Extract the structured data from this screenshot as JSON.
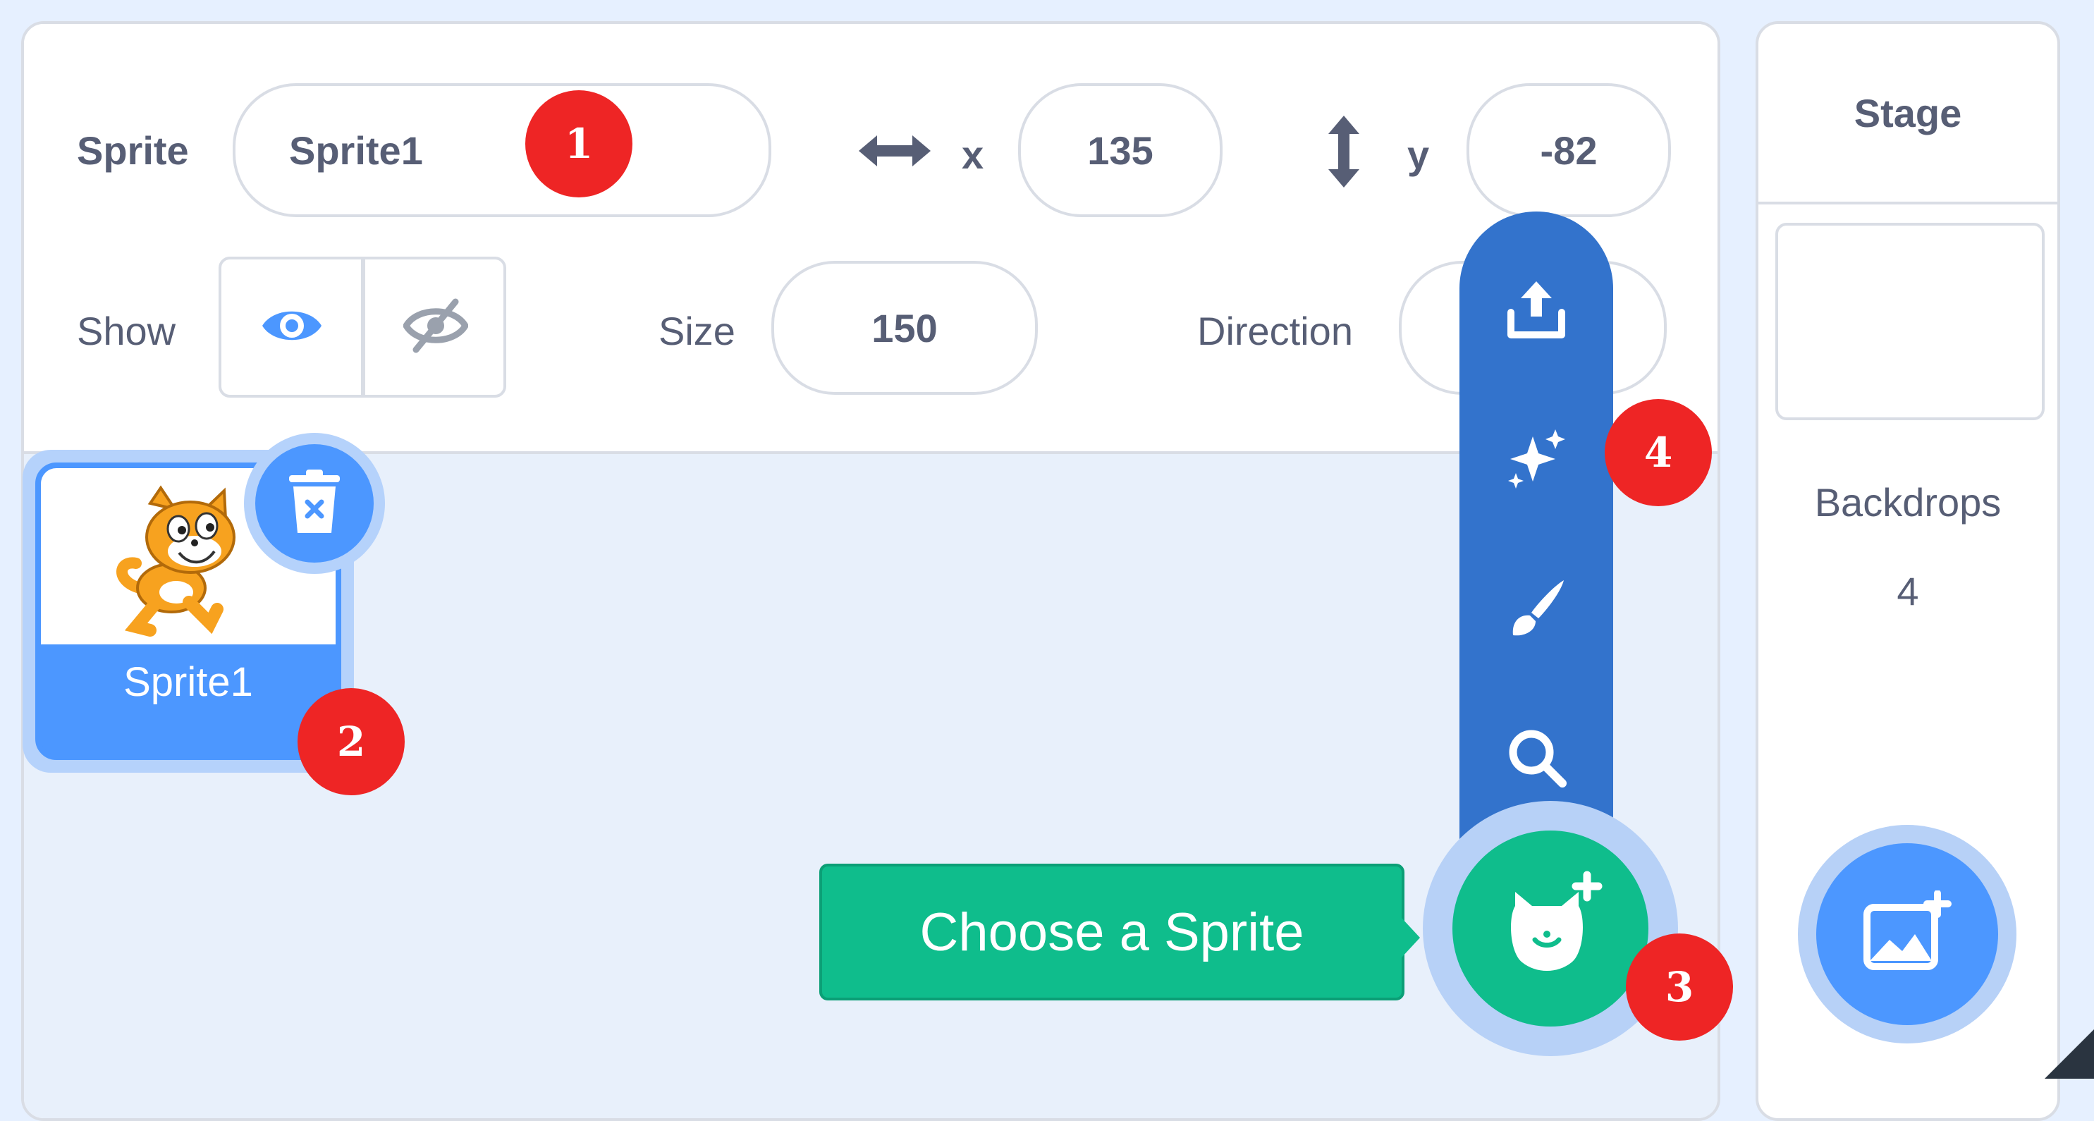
{
  "sprite_info": {
    "sprite_label": "Sprite",
    "sprite_name": "Sprite1",
    "x_label": "x",
    "x_value": "135",
    "y_label": "y",
    "y_value": "-82",
    "show_label": "Show",
    "size_label": "Size",
    "size_value": "150",
    "direction_label": "Direction",
    "direction_value": ""
  },
  "sprite_list": {
    "items": [
      {
        "name": "Sprite1",
        "selected": true
      }
    ]
  },
  "add_sprite_menu": {
    "items": [
      "upload-icon",
      "surprise-icon",
      "paint-icon",
      "search-icon"
    ],
    "tooltip": "Choose a Sprite"
  },
  "stage": {
    "title": "Stage",
    "backdrops_label": "Backdrops",
    "backdrops_count": "4"
  },
  "callouts": [
    "1",
    "2",
    "3",
    "4"
  ],
  "colors": {
    "accent_blue": "#4c97ff",
    "flyout_blue": "#3373cc",
    "green": "#0fbd8c",
    "callout_red": "#ee2525",
    "text": "#575e75"
  }
}
